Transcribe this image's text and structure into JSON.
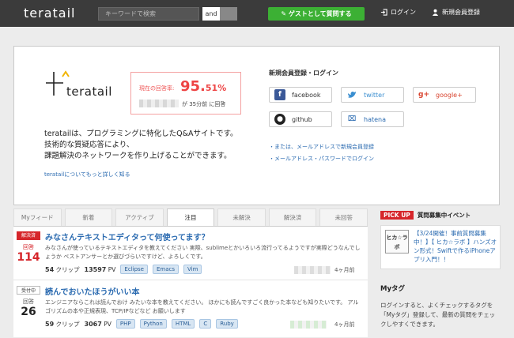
{
  "header": {
    "logo": "teratail",
    "search_placeholder": "キーワードで検索",
    "and_label": "and",
    "guest_button": "ゲストとして質問する",
    "login_label": "ログイン",
    "register_label": "新規会員登録",
    "colors": {
      "bar": "#3b3b3b",
      "guest": "#3cb034"
    }
  },
  "hero": {
    "brand_name": "teratail",
    "rate_label": "現在の回答率:",
    "rate_value_int": "95.",
    "rate_value_dec": "51%",
    "rate_time": "が 35分前 に回答",
    "intro_lines": [
      "teratailは、プログラミングに特化したQ&Aサイトです。",
      "技術的な質疑応答により、",
      "課題解決のネットワークを作り上げることができます。"
    ],
    "more_link": "teratailについてもっと詳しく知る",
    "auth_title": "新規会員登録・ログイン",
    "buttons": {
      "facebook": "facebook",
      "twitter": "twitter",
      "google": "google+",
      "github": "github",
      "hatena": "hatena"
    },
    "email_register": "・または、メールアドレスで新規会員登録",
    "email_login": "・メールアドレス・パスワードでログイン"
  },
  "tabs": [
    "Myフィード",
    "新着",
    "アクティブ",
    "注目",
    "未解決",
    "解決済",
    "未回答"
  ],
  "active_tab": "注目",
  "questions": [
    {
      "status": "解決済",
      "count_label": "回答",
      "count": "114",
      "title": "みなさんテキストエディタって何使ってます？",
      "excerpt": "みなさんが使っているテキストエディタを教えてください 実際、sublimeとかいろいろ流行ってるようですが実際どうなんでしょうか ベストアンサーとか選びづらいですけど、よろしくです。",
      "clips": "54",
      "clip_unit": "クリップ",
      "pv": "13597",
      "pv_unit": "PV",
      "tags": [
        "Eclipse",
        "Emacs",
        "Vim"
      ],
      "ago": "4ヶ月前"
    },
    {
      "status": "受付中",
      "count_label": "回答",
      "count": "26",
      "title": "読んでおいたほうがいい本",
      "excerpt": "エンジニアならこれは読んでおけ みたいな本を教えてください。 ほかにも読んですごく良かった本なども知りたいです。 アルゴリズムの本や正規表現、TCP/IPなどなど お願いします",
      "clips": "59",
      "clip_unit": "クリップ",
      "pv": "3067",
      "pv_unit": "PV",
      "tags": [
        "PHP",
        "Python",
        "HTML",
        "C",
        "Ruby"
      ],
      "ago": "4ヶ月前"
    }
  ],
  "sidebar": {
    "pickup_label": "PICK UP",
    "pickup_heading": "質問募集中イベント",
    "event_img_text": "ヒカ☆ラボ",
    "event_text": "【3/24開催！事前質問募集中！】【 ヒカ☆ラボ 】ハンズオン形式！Swiftで作るiPhoneアプリ入門！！",
    "tags_title": "Myタグ",
    "tags_text": "ログインすると、よくチェックするタグを「Myタグ」登録して、最新の質問をチェックしやすくできます。"
  }
}
